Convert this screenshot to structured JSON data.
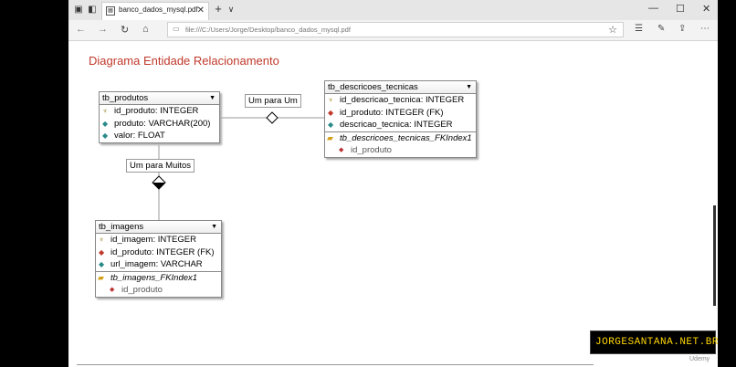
{
  "browser": {
    "tab_title": "banco_dados_mysql.pdf",
    "tab_close": "✕",
    "new_tab": "+",
    "tab_menu": "∨",
    "win_min": "—",
    "win_max": "☐",
    "win_close": "✕",
    "url": "file:///C:/Users/Jorge/Desktop/banco_dados_mysql.pdf"
  },
  "diagram": {
    "title": "Diagrama Entidade Relacionamento",
    "tables": [
      {
        "name": "tb_produtos",
        "fields": [
          {
            "key": "pk",
            "text": "id_produto: INTEGER"
          },
          {
            "key": "col",
            "text": "produto: VARCHAR(200)"
          },
          {
            "key": "col",
            "text": "valor: FLOAT"
          }
        ]
      },
      {
        "name": "tb_descricoes_tecnicas",
        "fields": [
          {
            "key": "pk",
            "text": "id_descricao_tecnica: INTEGER"
          },
          {
            "key": "fk",
            "text": "id_produto: INTEGER (FK)"
          },
          {
            "key": "col",
            "text": "descricao_tecnica: INTEGER"
          }
        ],
        "index": "tb_descricoes_tecnicas_FKIndex1",
        "index_field": "id_produto"
      },
      {
        "name": "tb_imagens",
        "fields": [
          {
            "key": "pk",
            "text": "id_imagem: INTEGER"
          },
          {
            "key": "fk",
            "text": "id_produto: INTEGER (FK)"
          },
          {
            "key": "col",
            "text": "url_imagem: VARCHAR"
          }
        ],
        "index": "tb_imagens_FKIndex1",
        "index_field": "id_produto"
      }
    ],
    "relations": {
      "one_to_one": "Um para Um",
      "one_to_many": "Um para Muitos"
    }
  },
  "watermark": "JORGESANTANA.NET.BR",
  "brand": "Udemy"
}
